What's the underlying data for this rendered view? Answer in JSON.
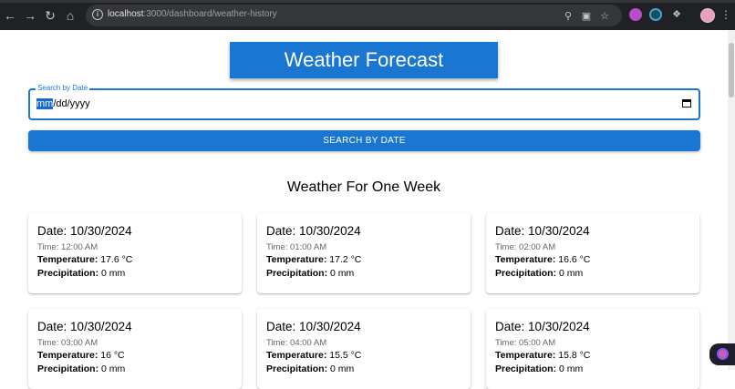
{
  "browser": {
    "url_host": "localhost",
    "url_path": ":3000/dashboard/weather-history"
  },
  "header": {
    "title": "Weather Forecast"
  },
  "search": {
    "label": "Search by Date",
    "value_selected": "mm",
    "value_rest": "/dd/yyyy",
    "button_label": "SEARCH BY DATE"
  },
  "section": {
    "title": "Weather For One Week"
  },
  "labels": {
    "date": "Date:",
    "time": "Time:",
    "temperature": "Temperature:",
    "precipitation": "Precipitation:"
  },
  "forecasts": [
    {
      "date": "10/30/2024",
      "time": "12:00 AM",
      "temperature": "17.6 °C",
      "precipitation": "0 mm"
    },
    {
      "date": "10/30/2024",
      "time": "01:00 AM",
      "temperature": "17.2 °C",
      "precipitation": "0 mm"
    },
    {
      "date": "10/30/2024",
      "time": "02:00 AM",
      "temperature": "16.6 °C",
      "precipitation": "0 mm"
    },
    {
      "date": "10/30/2024",
      "time": "03:00 AM",
      "temperature": "16 °C",
      "precipitation": "0 mm"
    },
    {
      "date": "10/30/2024",
      "time": "04:00 AM",
      "temperature": "15.5 °C",
      "precipitation": "0 mm"
    },
    {
      "date": "10/30/2024",
      "time": "05:00 AM",
      "temperature": "15.8 °C",
      "precipitation": "0 mm"
    }
  ],
  "colors": {
    "primary": "#1976d2",
    "chrome": "#202124"
  },
  "icons": [
    "back-arrow-icon",
    "forward-arrow-icon",
    "reload-icon",
    "home-icon",
    "site-info-icon",
    "location-icon",
    "cast-icon",
    "star-icon",
    "extensions-icon",
    "calendar-icon"
  ]
}
